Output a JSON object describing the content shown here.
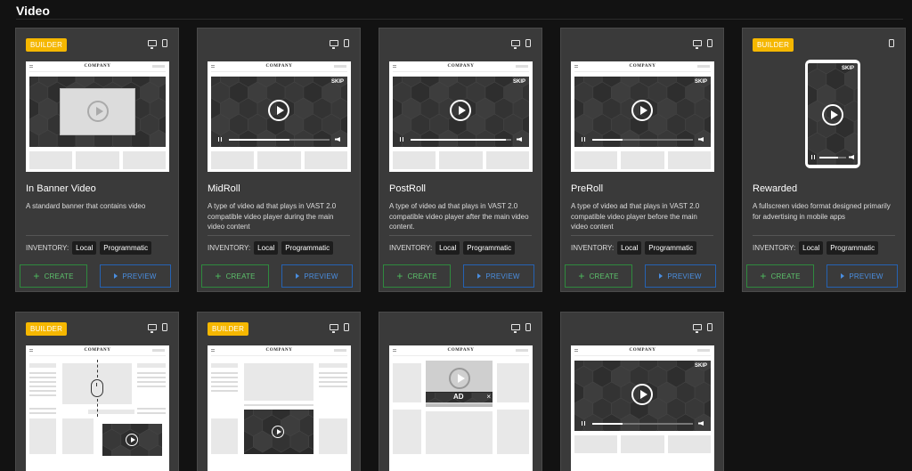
{
  "section": {
    "title": "Video"
  },
  "badge_label": "BUILDER",
  "inventory_label": "INVENTORY:",
  "tags": {
    "local": "Local",
    "programmatic": "Programmatic"
  },
  "buttons": {
    "create": "CREATE",
    "preview": "PREVIEW"
  },
  "preview": {
    "logo": "COMPANY",
    "skip": "SKIP",
    "ad": "AD"
  },
  "cards": [
    {
      "title": "In Banner Video",
      "description": "A standard banner that contains video",
      "builder": true,
      "devices": [
        "desktop-icon",
        "mobile-icon"
      ]
    },
    {
      "title": "MidRoll",
      "description": "A type of video ad that plays in VAST 2.0 compatible video player during the main video content",
      "builder": false,
      "devices": [
        "desktop-icon",
        "mobile-icon"
      ],
      "progress": 0.6
    },
    {
      "title": "PostRoll",
      "description": "A type of video ad that plays in VAST 2.0 compatible video player after the main video content.",
      "builder": false,
      "devices": [
        "desktop-icon",
        "mobile-icon"
      ],
      "progress": 0.95
    },
    {
      "title": "PreRoll",
      "description": "A type of video ad that plays in VAST 2.0 compatible video player before the main video content",
      "builder": false,
      "devices": [
        "desktop-icon",
        "mobile-icon"
      ],
      "progress": 0.3
    },
    {
      "title": "Rewarded",
      "description": "A fullscreen video format designed primarily for advertising in mobile apps",
      "builder": true,
      "devices": [
        "mobile-icon"
      ],
      "progress": 0.7
    }
  ],
  "colors": {
    "builder": "#f5b700",
    "create": "#2f8a3e",
    "preview": "#2562b3",
    "card": "#3a3a3a",
    "background": "#121212"
  }
}
